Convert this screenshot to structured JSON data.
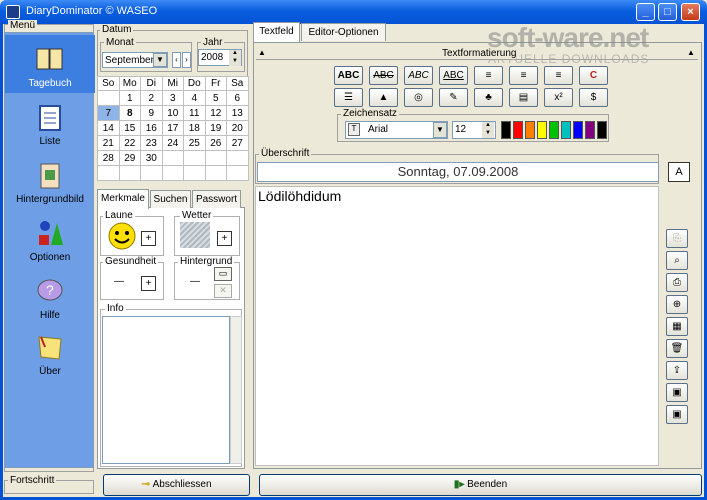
{
  "window": {
    "title": "DiaryDominator © WASEO",
    "minimize": "_",
    "maximize": "□",
    "close": "×"
  },
  "watermark": {
    "brand": "soft-ware.net",
    "tagline": "AKTUELLE DOWNLOADS"
  },
  "sidebar": {
    "header": "Menü",
    "footer": "Fortschritt",
    "items": [
      {
        "label": "Tagebuch",
        "icon": "book-icon",
        "active": true
      },
      {
        "label": "Liste",
        "icon": "list-icon"
      },
      {
        "label": "Hintergrundbild",
        "icon": "picture-icon"
      },
      {
        "label": "Optionen",
        "icon": "shapes-icon"
      },
      {
        "label": "Hilfe",
        "icon": "help-icon"
      },
      {
        "label": "Über",
        "icon": "note-icon"
      }
    ]
  },
  "datum": {
    "legend": "Datum",
    "monat_label": "Monat",
    "monat_value": "September",
    "jahr_label": "Jahr",
    "jahr_value": "2008",
    "weekdays": [
      "So",
      "Mo",
      "Di",
      "Mi",
      "Do",
      "Fr",
      "Sa"
    ],
    "weeks": [
      [
        "",
        "1",
        "2",
        "3",
        "4",
        "5",
        "6"
      ],
      [
        "7",
        "8",
        "9",
        "10",
        "11",
        "12",
        "13"
      ],
      [
        "14",
        "15",
        "16",
        "17",
        "18",
        "19",
        "20"
      ],
      [
        "21",
        "22",
        "23",
        "24",
        "25",
        "26",
        "27"
      ],
      [
        "28",
        "29",
        "30",
        "",
        "",
        "",
        ""
      ],
      [
        "",
        "",
        "",
        "",
        "",
        "",
        ""
      ]
    ],
    "selected_day": "7",
    "bold_day": "8"
  },
  "left_tabs": [
    "Merkmale",
    "Suchen",
    "Passwort"
  ],
  "merkmale": {
    "laune": "Laune",
    "wetter": "Wetter",
    "gesundheit": "Gesundheit",
    "gesundheit_value": "—",
    "hintergrund": "Hintergrund",
    "hintergrund_value": "—",
    "info": "Info",
    "plus": "+",
    "clear": "✕"
  },
  "buttons": {
    "lock": "Abschliessen",
    "exit": "Beenden"
  },
  "editor_tabs": [
    "Textfeld",
    "Editor-Optionen"
  ],
  "format": {
    "title": "Textformatierung",
    "row1": [
      "ABC",
      "ABC",
      "ABC",
      "ABC",
      "≡",
      "≡",
      "≡",
      "C"
    ],
    "row2": [
      "☰",
      "▲",
      "◎",
      "✎",
      "♣",
      "▤",
      "x²",
      "$"
    ],
    "font_legend": "Zeichensatz",
    "font_name": "Arial",
    "font_size": "12",
    "colors": [
      "#000000",
      "#ff0000",
      "#ff8000",
      "#ffff00",
      "#00c000",
      "#00c0c0",
      "#0000ff",
      "#800080",
      "#000000"
    ]
  },
  "heading": {
    "legend": "Überschrift",
    "value": "Sonntag, 07.09.2008",
    "button": "A"
  },
  "editor": {
    "content": "Lödilöhdidum"
  },
  "side_tools": [
    "copy-icon",
    "search-doc-icon",
    "print-icon",
    "zoom-icon",
    "grid-icon",
    "trash-icon",
    "export-icon",
    "save-red-icon",
    "save-icon"
  ]
}
